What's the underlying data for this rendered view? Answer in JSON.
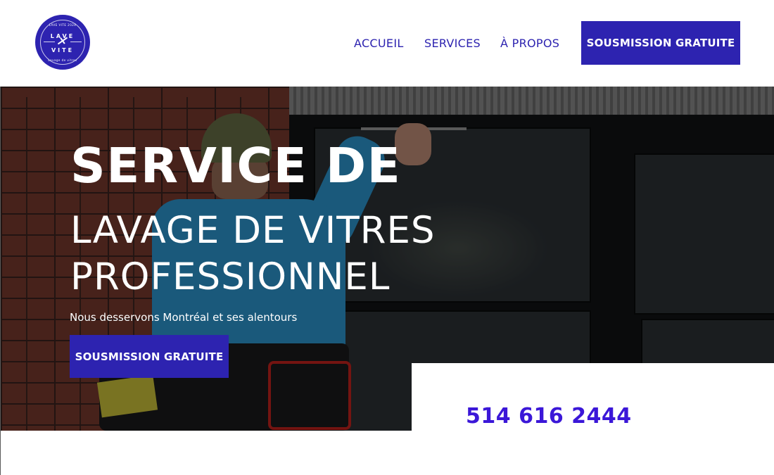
{
  "brand": {
    "logo_text_top": "LAVE",
    "logo_text_bottom": "VITE",
    "logo_ring_top": "LAVE VITE 2024",
    "logo_ring_bottom": "Lavage de vitres"
  },
  "nav": {
    "items": [
      {
        "label": "ACCUEIL"
      },
      {
        "label": "SERVICES"
      },
      {
        "label": "À PROPOS"
      }
    ],
    "cta_label": "SOUSMISSION GRATUITE"
  },
  "hero": {
    "title": "SERVICE DE",
    "line1": "LAVAGE DE VITRES",
    "line2": "PROFESSIONNEL",
    "subtitle": "Nous desservons Montréal et ses alentours",
    "cta_label": "SOUSMISSION GRATUITE"
  },
  "contact": {
    "phone": "514 616 2444"
  },
  "colors": {
    "brand": "#2d23b0",
    "phone": "#3b17d8",
    "text_light": "#ffffff"
  }
}
